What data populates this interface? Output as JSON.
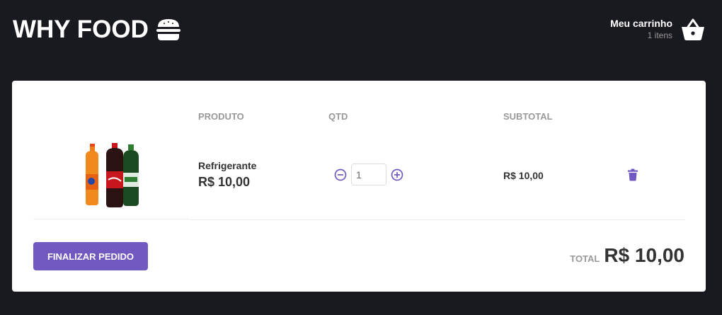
{
  "header": {
    "logo_text": "WHY FOOD",
    "cart_title": "Meu carrinho",
    "cart_count": "1 itens"
  },
  "table": {
    "col_product": "PRODUTO",
    "col_qty": "QTD",
    "col_subtotal": "SUBTOTAL"
  },
  "item": {
    "name": "Refrigerante",
    "price": "R$ 10,00",
    "quantity": "1",
    "subtotal": "R$ 10,00",
    "image": "soda-bottles"
  },
  "footer": {
    "checkout_label": "Finalizar pedido",
    "total_label": "TOTAL",
    "total_value": "R$ 10,00"
  },
  "colors": {
    "background": "#191920",
    "accent": "#7159c1",
    "panel": "#ffffff"
  },
  "icons": [
    "burger-icon",
    "cart-basket-icon",
    "minus-circle-icon",
    "plus-circle-icon",
    "trash-icon"
  ]
}
